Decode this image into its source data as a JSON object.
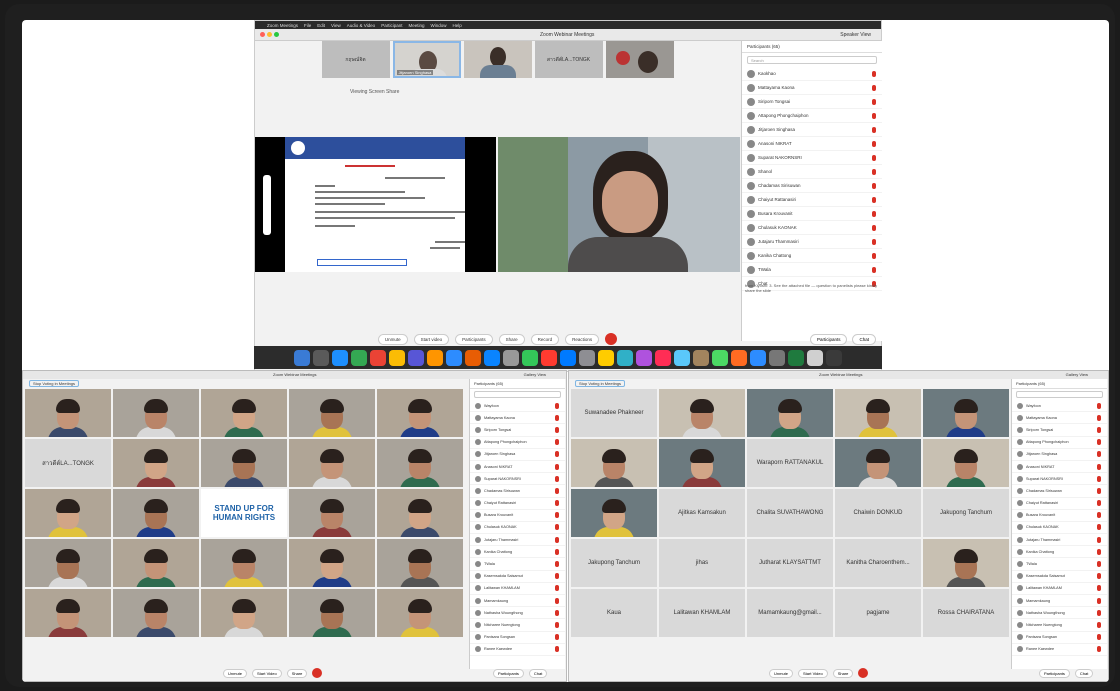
{
  "top": {
    "menubar": [
      "Zoom Meetings",
      "File",
      "Edit",
      "View",
      "Audio & Video",
      "Participant",
      "Meeting",
      "Window",
      "Help"
    ],
    "title": "Zoom Webinar Meetings",
    "view_label": "Speaker View",
    "viewing_text": "Viewing Screen Share",
    "thumbs": [
      "กฤษณ์จิต",
      "Jitjaroen Singhasa",
      "",
      "สาวดีต์LA...TONGK",
      ""
    ],
    "toolbar": [
      "Unmute",
      "Start video",
      "Participants",
      "Share",
      "Record",
      "Reactions"
    ],
    "participants_title": "Participants (65)",
    "search_placeholder": "Search",
    "participants": [
      "Kaokhao",
      "Mattayama Kaona",
      "Siriporn Tongsai",
      "Attapong Phongchaiphon",
      "Jitjaroen Singhasa",
      "Anasoni NIKRAT",
      "Suparat NAKORNSRI",
      "Shanol",
      "Chadamas Sirisuwan",
      "Chaiyut Rattanasiri",
      "Busara Krouvanit",
      "Chulasuk KAONAK",
      "Jutajaru Thammasiri",
      "Kanika Chattong",
      "TWala",
      "Chat"
    ],
    "chat_text": "from Kiyoshi: 3. See the attached file — question to panelists please kindly share the slide",
    "chat_footer": [
      "Participants",
      "Chat"
    ]
  },
  "left": {
    "title": "Zoom Webinar Meetings",
    "view_label": "Gallery View",
    "banner": "Stop Voting in Meetings",
    "tiles": [
      "",
      "",
      "",
      "",
      "",
      "สาวดีต์LA...TONGK",
      "",
      "",
      "",
      "",
      "",
      "",
      "STAND UP FOR HUMAN RIGHTS",
      "",
      "",
      "",
      "",
      "",
      "",
      "",
      "",
      "",
      "",
      "",
      ""
    ],
    "participants_title": "Participants (65)",
    "toolbar": [
      "Unmute",
      "Start Video",
      "Share",
      "Participants",
      "Chat"
    ]
  },
  "right": {
    "title": "Zoom Webinar Meetings",
    "view_label": "Gallery View",
    "banner": "Stop Voting in Meetings",
    "tiles": [
      "Suwanadee Phakneer",
      "",
      "",
      "",
      "",
      "",
      "",
      "Waraporn RATTANAKUL",
      "",
      "",
      "",
      "Ajitkas Kamsakun",
      "Chalita SUVATHAWONG",
      "Chaiwin DONKUD",
      "Jakupong Tanchum",
      "Jakupong Tanchum",
      "jihas",
      "Jutharat KLAYSATTMT",
      "Kanitha Charoenthem...",
      "",
      "Kaua",
      "Lalitawan KHAMLAM",
      "Mamamkaung@gmail...",
      "pagjame",
      "Rossa CHAIRATANA"
    ],
    "participants_title": "Participants (65)",
    "participants": [
      "Wayfoon",
      "Mattayama Kaona",
      "Siriporn Tongsai",
      "Attapong Phongchaiphon",
      "Jitjaroen Singhasa",
      "Anasoni NIKRAT",
      "Suparat NAKORNSRI",
      "Chadamas Sirisuwan",
      "Chaiyut Rattanasiri",
      "Busara Krouvanit",
      "Chulasuk KAONAK",
      "Jutajaru Thammasiri",
      "Kanika Chattong",
      "TWala",
      "Kasemsakda Saisamut",
      "Lalitawan KHAMLAM",
      "Mamamkaung",
      "Nathasha Woungthong",
      "Nitcharee Nuengtong",
      "Panisara Songsan",
      "Ranee Kaewdee"
    ],
    "toolbar": [
      "Unmute",
      "Start Video",
      "Share",
      "Participants",
      "Chat"
    ]
  },
  "colors": {
    "accent": "#2d8cff",
    "red": "#d93025",
    "dock": "#2c2c2c"
  }
}
